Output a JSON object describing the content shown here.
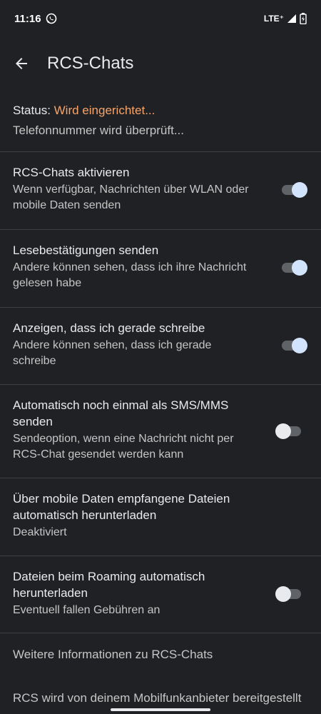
{
  "status_bar": {
    "time": "11:16",
    "network": "LTE⁺",
    "icons": [
      "whatsapp-icon",
      "signal-icon",
      "battery-charging-icon"
    ]
  },
  "app_bar": {
    "title": "RCS-Chats",
    "back_icon": "arrow-left-icon"
  },
  "status": {
    "label": "Status: ",
    "value": "Wird eingerichtet...",
    "detail": "Telefonnummer wird überprüft..."
  },
  "settings": [
    {
      "title": "RCS-Chats aktivieren",
      "summary": "Wenn verfügbar, Nachrichten über WLAN oder mobile Daten senden",
      "toggle": true
    },
    {
      "title": "Lesebestätigungen senden",
      "summary": "Andere können sehen, dass ich ihre Nachricht gelesen habe",
      "toggle": true
    },
    {
      "title": "Anzeigen, dass ich gerade schreibe",
      "summary": "Andere können sehen, dass ich gerade schreibe",
      "toggle": true
    },
    {
      "title": "Automatisch noch einmal als SMS/MMS senden",
      "summary": "Sendeoption, wenn eine Nachricht nicht per RCS-Chat gesendet werden kann",
      "toggle": false
    },
    {
      "title": "Über mobile Daten empfangene Dateien automatisch herunterladen",
      "summary": "Deaktiviert"
    },
    {
      "title": "Dateien beim Roaming automatisch herunterladen",
      "summary": "Eventuell fallen Gebühren an",
      "toggle": false
    }
  ],
  "more_info": "Weitere Informationen zu RCS-Chats",
  "footer": "RCS wird von deinem Mobilfunkanbieter bereitgestellt",
  "colors": {
    "background": "#202124",
    "status_accent": "#f5a46b",
    "toggle_on_knob": "#d2e3fc"
  }
}
